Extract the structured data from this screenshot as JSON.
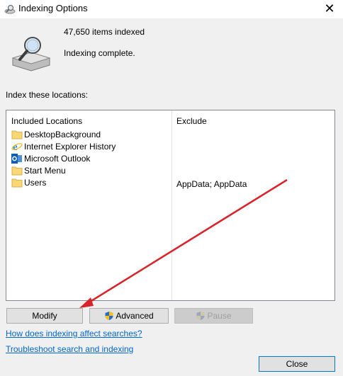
{
  "window": {
    "title": "Indexing Options"
  },
  "status": {
    "items_indexed": "47,650 items indexed",
    "state": "Indexing complete."
  },
  "section_label": "Index these locations:",
  "table": {
    "col_included": "Included Locations",
    "col_exclude": "Exclude",
    "rows": [
      {
        "location": "DesktopBackground",
        "exclude": "",
        "icon": "folder-icon"
      },
      {
        "location": "Internet Explorer History",
        "exclude": "",
        "icon": "internet-explorer-icon"
      },
      {
        "location": "Microsoft Outlook",
        "exclude": "",
        "icon": "outlook-icon"
      },
      {
        "location": "Start Menu",
        "exclude": "",
        "icon": "folder-icon"
      },
      {
        "location": "Users",
        "exclude": "AppData; AppData",
        "icon": "folder-icon"
      }
    ]
  },
  "buttons": {
    "modify": "Modify",
    "advanced": "Advanced",
    "pause": "Pause",
    "close": "Close"
  },
  "links": {
    "how": "How does indexing affect searches?",
    "troubleshoot": "Troubleshoot search and indexing"
  },
  "colors": {
    "accent": "#0078d7",
    "link": "#0066cc",
    "annotation_arrow": "#d9232a"
  }
}
